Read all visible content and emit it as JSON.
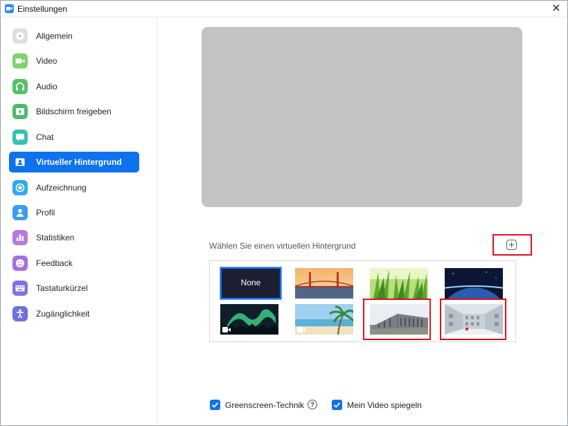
{
  "window": {
    "title": "Einstellungen",
    "close_symbol": "✕"
  },
  "sidebar": {
    "items": [
      {
        "label": "Allgemein",
        "icon": "gear-icon",
        "color": "#c9c9cc",
        "active": false
      },
      {
        "label": "Video",
        "icon": "video-camera-icon",
        "color": "#7ed46b",
        "active": false
      },
      {
        "label": "Audio",
        "icon": "headphones-icon",
        "color": "#55c267",
        "active": false
      },
      {
        "label": "Bildschirm freigeben",
        "icon": "share-screen-icon",
        "color": "#4dbb6a",
        "active": false
      },
      {
        "label": "Chat",
        "icon": "chat-bubble-icon",
        "color": "#35c1b3",
        "active": false
      },
      {
        "label": "Virtueller Hintergrund",
        "icon": "person-card-icon",
        "color": "#0e72ed",
        "active": true
      },
      {
        "label": "Aufzeichnung",
        "icon": "record-icon",
        "color": "#2fa9f2",
        "active": false
      },
      {
        "label": "Profil",
        "icon": "profile-icon",
        "color": "#3c9cf0",
        "active": false
      },
      {
        "label": "Statistiken",
        "icon": "bar-chart-icon",
        "color": "#b47cde",
        "active": false
      },
      {
        "label": "Feedback",
        "icon": "smiley-icon",
        "color": "#a36ee6",
        "active": false
      },
      {
        "label": "Tastaturkürzel",
        "icon": "keyboard-icon",
        "color": "#7b73e6",
        "active": false
      },
      {
        "label": "Zugänglichkeit",
        "icon": "accessibility-icon",
        "color": "#6e6fe0",
        "active": false
      }
    ]
  },
  "main": {
    "choose_label": "Wählen Sie einen virtuellen Hintergrund",
    "backgrounds": [
      {
        "label": "None",
        "kind": "none"
      },
      {
        "name": "golden-gate-bridge",
        "kind": "image"
      },
      {
        "name": "grass",
        "kind": "image"
      },
      {
        "name": "earth-from-space",
        "kind": "image"
      },
      {
        "name": "northern-lights",
        "kind": "video"
      },
      {
        "name": "beach-palm",
        "kind": "video"
      },
      {
        "name": "building-exterior",
        "kind": "image",
        "highlighted": true
      },
      {
        "name": "building-atrium",
        "kind": "image",
        "highlighted": true
      }
    ],
    "options": {
      "greenscreen_label": "Greenscreen-Technik",
      "greenscreen_checked": true,
      "help_symbol": "?",
      "mirror_label": "Mein Video spiegeln",
      "mirror_checked": true
    }
  },
  "colors": {
    "accent": "#0e72ed",
    "highlight": "#e0101a",
    "preview": "#c3c3c3"
  }
}
